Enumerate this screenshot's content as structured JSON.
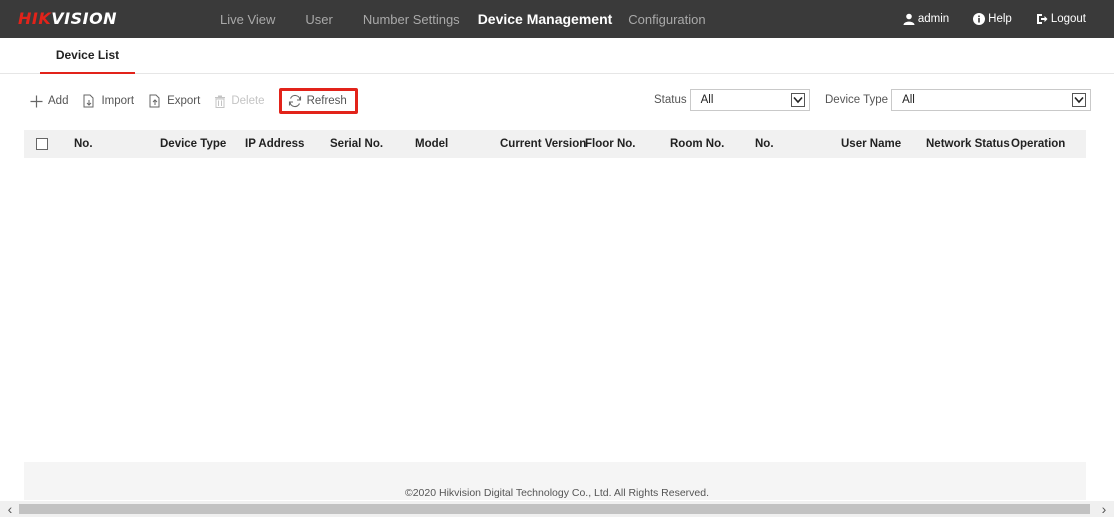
{
  "header": {
    "logo_red": "HIK",
    "logo_white": "VISION",
    "nav": [
      {
        "label": "Live View"
      },
      {
        "label": "User"
      },
      {
        "label": "Number Settings"
      },
      {
        "label": "Device Management"
      },
      {
        "label": "Configuration"
      }
    ],
    "user_label": "admin",
    "help_label": "Help",
    "logout_label": "Logout"
  },
  "tabs": [
    {
      "label": "Device List"
    }
  ],
  "toolbar": {
    "add_label": "Add",
    "import_label": "Import",
    "export_label": "Export",
    "delete_label": "Delete",
    "refresh_label": "Refresh"
  },
  "filters": {
    "status_label": "Status",
    "status_value": "All",
    "device_type_label": "Device Type",
    "device_type_value": "All"
  },
  "table": {
    "columns": [
      "No.",
      "Device Type",
      "IP Address",
      "Serial No.",
      "Model",
      "Current Version",
      "Floor No.",
      "Room No.",
      "No.",
      "User Name",
      "Network Status",
      "Operation"
    ]
  },
  "footer": {
    "copyright": "©2020 Hikvision Digital Technology Co., Ltd. All Rights Reserved."
  },
  "colors": {
    "accent": "#e2231a",
    "topbar": "#3a3a3a"
  }
}
